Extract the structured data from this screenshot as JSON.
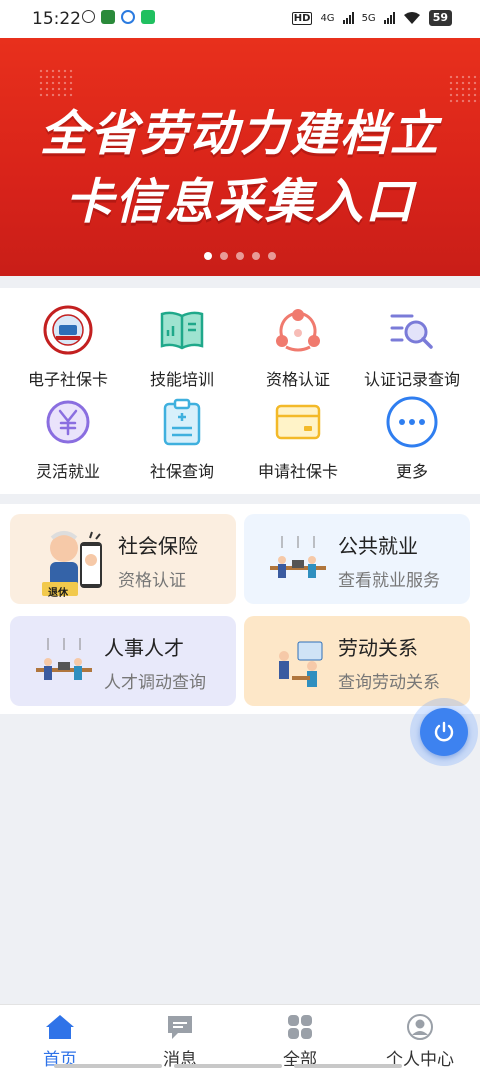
{
  "status_bar": {
    "time": "15:22",
    "battery": "59",
    "network_a": "4G",
    "network_b": "5G",
    "hd": "HD"
  },
  "banner": {
    "line1": "全省劳动力建档立",
    "line2": "卡信息采集入口",
    "page_count": 5,
    "active_page": 1
  },
  "services": [
    {
      "label": "电子社保卡",
      "icon": "social-security-card-icon"
    },
    {
      "label": "技能培训",
      "icon": "book-icon"
    },
    {
      "label": "资格认证",
      "icon": "people-network-icon"
    },
    {
      "label": "认证记录查询",
      "icon": "search-list-icon"
    },
    {
      "label": "灵活就业",
      "icon": "yuan-icon"
    },
    {
      "label": "社保查询",
      "icon": "clipboard-icon"
    },
    {
      "label": "申请社保卡",
      "icon": "card-icon"
    },
    {
      "label": "更多",
      "icon": "more-icon"
    }
  ],
  "cards": [
    {
      "title": "社会保险",
      "subtitle": "资格认证",
      "color": "#fbeee0",
      "badge": "退休"
    },
    {
      "title": "公共就业",
      "subtitle": "查看就业服务",
      "color": "#eef5fe"
    },
    {
      "title": "人事人才",
      "subtitle": "人才调动查询",
      "color": "#e8e9fa"
    },
    {
      "title": "劳动关系",
      "subtitle": "查询劳动关系",
      "color": "#fde7c8"
    }
  ],
  "tabs": [
    {
      "label": "首页",
      "icon": "home-icon",
      "active": true
    },
    {
      "label": "消息",
      "icon": "message-icon",
      "active": false
    },
    {
      "label": "全部",
      "icon": "grid-icon",
      "active": false
    },
    {
      "label": "个人中心",
      "icon": "user-icon",
      "active": false
    }
  ],
  "colors": {
    "accent": "#2f73e8",
    "banner": "#d8231a"
  }
}
